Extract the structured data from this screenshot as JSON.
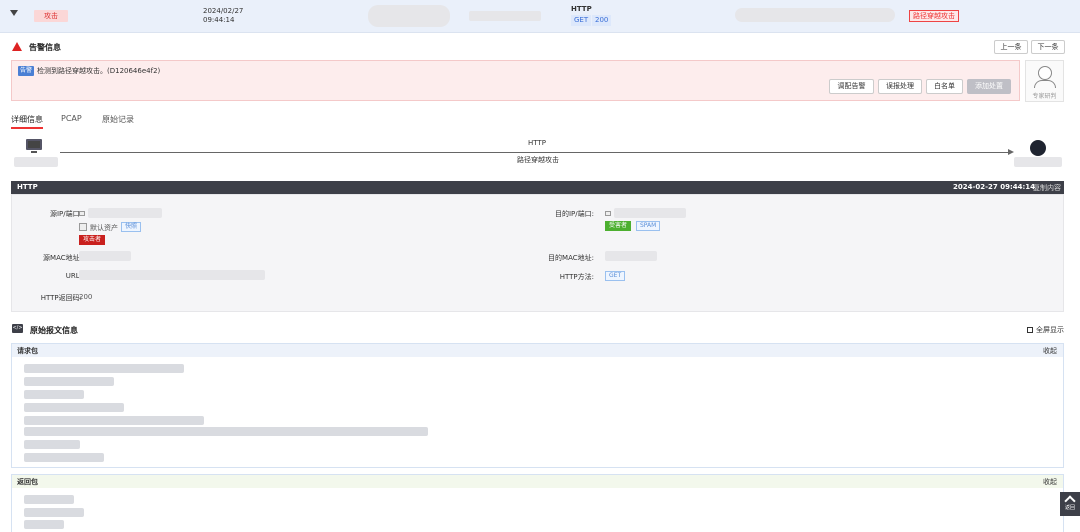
{
  "top_row": {
    "attack_tag": "攻击",
    "date": "2024/02/27",
    "time": "09:44:14",
    "protocol": "HTTP",
    "method": "GET",
    "status_code": "200",
    "threat_type": "路径穿越攻击"
  },
  "alert": {
    "title": "告警信息",
    "prev": "上一条",
    "next": "下一条",
    "badge": "告警",
    "message": "检测到路径穿越攻击。(D120646e4f2)",
    "actions": [
      "调配告警",
      "误报处理",
      "白名单",
      "添加处置"
    ],
    "expert_label": "专家研判"
  },
  "tabs": [
    "详细信息",
    "PCAP",
    "原始记录"
  ],
  "flow": {
    "protocol": "HTTP",
    "threat": "路径穿越攻击"
  },
  "http": {
    "title": "HTTP",
    "timestamp": "2024-02-27 09:44:14",
    "copy": "复制内容",
    "src_label": "源IP/端口:",
    "src_asset": "默认资产",
    "src_snapshot": "快照",
    "src_role": "攻击者",
    "dst_label": "目的IP/端口:",
    "dst_role": "受害者",
    "dst_tag": "SPAM",
    "src_mac_label": "源MAC地址:",
    "dst_mac_label": "目的MAC地址:",
    "url_label": "URL:",
    "method_label": "HTTP方法:",
    "method_value": "GET",
    "code_label": "HTTP返回码:",
    "code_value": "200"
  },
  "raw": {
    "title": "原始报文信息",
    "fullscreen": "全屏显示",
    "request_label": "请求包",
    "response_label": "返回包",
    "collapse": "收起"
  },
  "back_top": "返回"
}
